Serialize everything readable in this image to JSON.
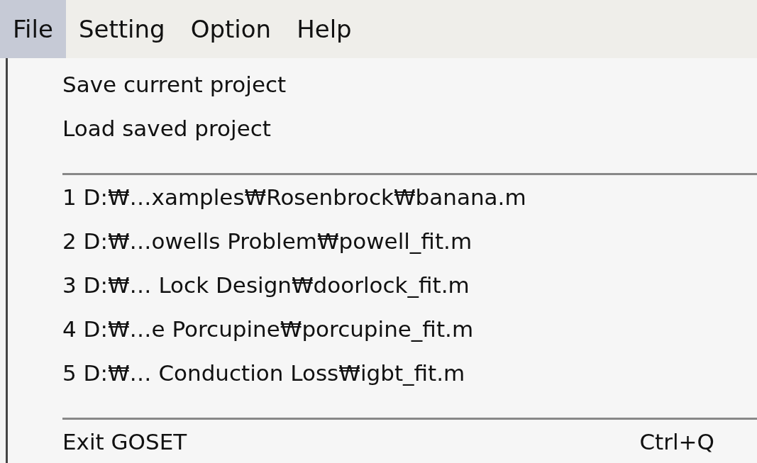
{
  "menu_bar": [
    {
      "label": "File",
      "selected": true
    },
    {
      "label": "Setting",
      "selected": false
    },
    {
      "label": "Option",
      "selected": false
    },
    {
      "label": "Help",
      "selected": false
    }
  ],
  "menu": [
    {
      "kind": "item",
      "label": "Save current project"
    },
    {
      "kind": "item",
      "label": "Load saved project"
    },
    {
      "kind": "separator"
    },
    {
      "kind": "item",
      "label": "1 D:₩…xamples₩Rosenbrock₩banana.m"
    },
    {
      "kind": "item",
      "label": "2 D:₩…owells Problem₩powell_fit.m"
    },
    {
      "kind": "item",
      "label": "3 D:₩… Lock Design₩doorlock_fit.m"
    },
    {
      "kind": "item",
      "label": "4 D:₩…e Porcupine₩porcupine_fit.m"
    },
    {
      "kind": "item",
      "label": "5 D:₩… Conduction Loss₩igbt_fit.m"
    },
    {
      "kind": "separator"
    },
    {
      "kind": "item",
      "label": "Exit GOSET",
      "shortcut": "Ctrl+Q"
    }
  ]
}
